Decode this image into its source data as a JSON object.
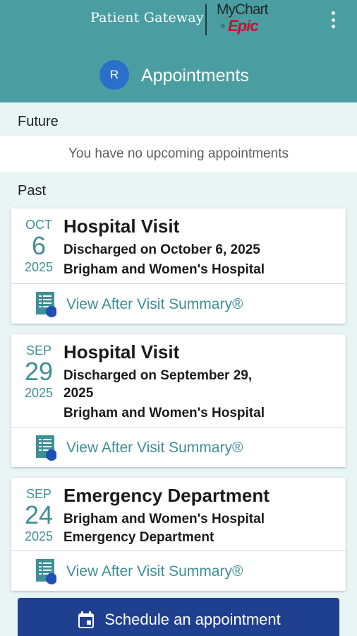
{
  "header": {
    "brand": "Patient Gateway",
    "logo_mychart": "MyChart",
    "logo_is": "is",
    "logo_epic": "Epic",
    "avatar_initial": "R",
    "title": "Appointments"
  },
  "future": {
    "label": "Future",
    "empty_message": "You have no upcoming appointments"
  },
  "past": {
    "label": "Past",
    "visits": [
      {
        "month": "OCT",
        "day": "6",
        "year": "2025",
        "title": "Hospital Visit",
        "line1": "Discharged on October 6, 2025",
        "line2": "Brigham and Women's Hospital",
        "link": "View After Visit Summary®"
      },
      {
        "month": "SEP",
        "day": "29",
        "year": "2025",
        "title": "Hospital Visit",
        "line1": "Discharged on September 29, 2025",
        "line2": "Brigham and Women's Hospital",
        "link": "View After Visit Summary®"
      },
      {
        "month": "SEP",
        "day": "24",
        "year": "2025",
        "title": "Emergency Department",
        "line1": "Brigham and Women's Hospital",
        "line2": "Emergency Department",
        "link": "View After Visit Summary®"
      }
    ]
  },
  "actions": {
    "schedule_label": "Schedule an appointment"
  },
  "icons": {
    "menu": "more-vertical-icon",
    "document": "document-icon",
    "calendar": "calendar-icon"
  },
  "colors": {
    "header_bg": "#4a9ea2",
    "accent_teal": "#3f8f96",
    "avatar_blue": "#2a6fc9",
    "button_navy": "#1f3f8f",
    "epic_red": "#c8102e"
  }
}
